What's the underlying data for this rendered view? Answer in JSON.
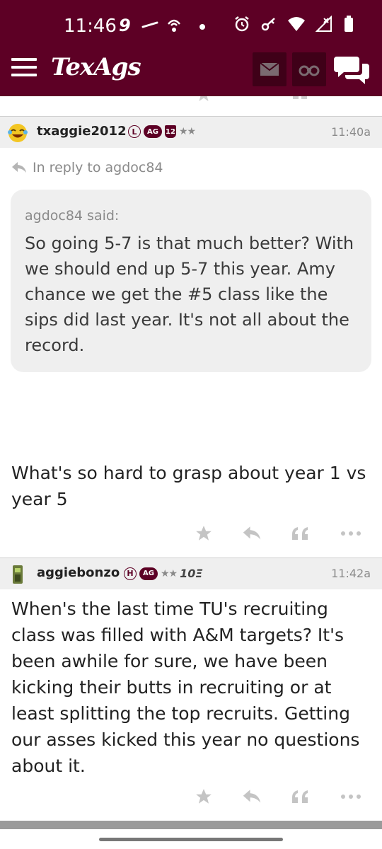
{
  "status_bar": {
    "time": "11:46"
  },
  "app": {
    "brand": "TexAgs"
  },
  "posts": [
    {
      "username": "txaggie2012",
      "badges": [
        "L",
        "AG",
        "12"
      ],
      "stars": "★★",
      "time": "11:40a",
      "reply_to": "In reply to agdoc84",
      "quote": {
        "author": "agdoc84 said:",
        "text": "So going 5-7 is that much better? With we should end up 5-7 this year. Amy chance we get the #5 class like the sips did last year. It's not all about the record."
      },
      "body": "What's so hard to grasp about year 1 vs year 5"
    },
    {
      "username": "aggiebonzo",
      "badges": [
        "H",
        "AG"
      ],
      "stars": "★★",
      "tenth": "10Ξ",
      "time": "11:42a",
      "body": "When's the last time TU's recruiting class was filled with A&M targets? It's been awhile for sure, we have been kicking their butts in recruiting or at least splitting the top recruits. Getting our asses kicked this year no questions about it."
    }
  ]
}
